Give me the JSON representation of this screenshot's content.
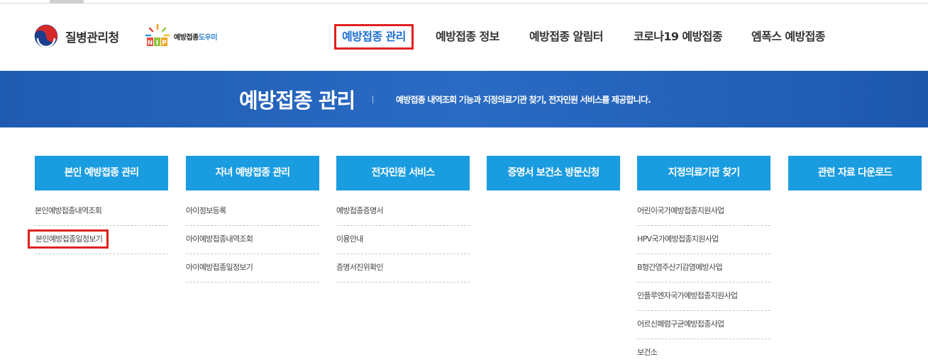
{
  "header": {
    "kdca_name": "질병관리청",
    "nip_name_prefix": "예방접종",
    "nip_name_highlight": "도우미",
    "nip_badge": "NIP"
  },
  "gnb": {
    "items": [
      {
        "label": "예방접종 관리",
        "active": true
      },
      {
        "label": "예방접종 정보",
        "active": false
      },
      {
        "label": "예방접종 알림터",
        "active": false
      },
      {
        "label": "코로나19 예방접종",
        "active": false
      },
      {
        "label": "엠폭스 예방접종",
        "active": false
      }
    ]
  },
  "banner": {
    "title": "예방접종 관리",
    "description": "예방접종 내역조회 기능과 지정의료기관 찾기, 전자민원 서비스를 제공합니다."
  },
  "columns": [
    {
      "title": "본인 예방접종 관리",
      "items": [
        "본인예방접종내역조회",
        "본인예방접종일정보기"
      ]
    },
    {
      "title": "자녀 예방접종 관리",
      "items": [
        "아이정보등록",
        "아이예방접종내역조회",
        "아이예방접종일정보기"
      ]
    },
    {
      "title": "전자민원 서비스",
      "items": [
        "예방접종증명서",
        "이용안내",
        "증명서진위확인"
      ]
    },
    {
      "title": "증명서 보건소 방문신청",
      "items": []
    },
    {
      "title": "지정의료기관 찾기",
      "items": [
        "어린이국가예방접종지원사업",
        "HPV국가예방접종지원사업",
        "B형간염주산기감염예방사업",
        "인플루엔자국가예방접종지원사업",
        "어르신폐렴구균예방접종사업",
        "보건소"
      ]
    },
    {
      "title": "관련 자료 다운로드",
      "items": []
    }
  ],
  "colors": {
    "accent_blue": "#1a9ce0",
    "banner_blue": "#2a6bc4",
    "highlight_red": "#e02020",
    "active_text": "#1c6fd0"
  }
}
